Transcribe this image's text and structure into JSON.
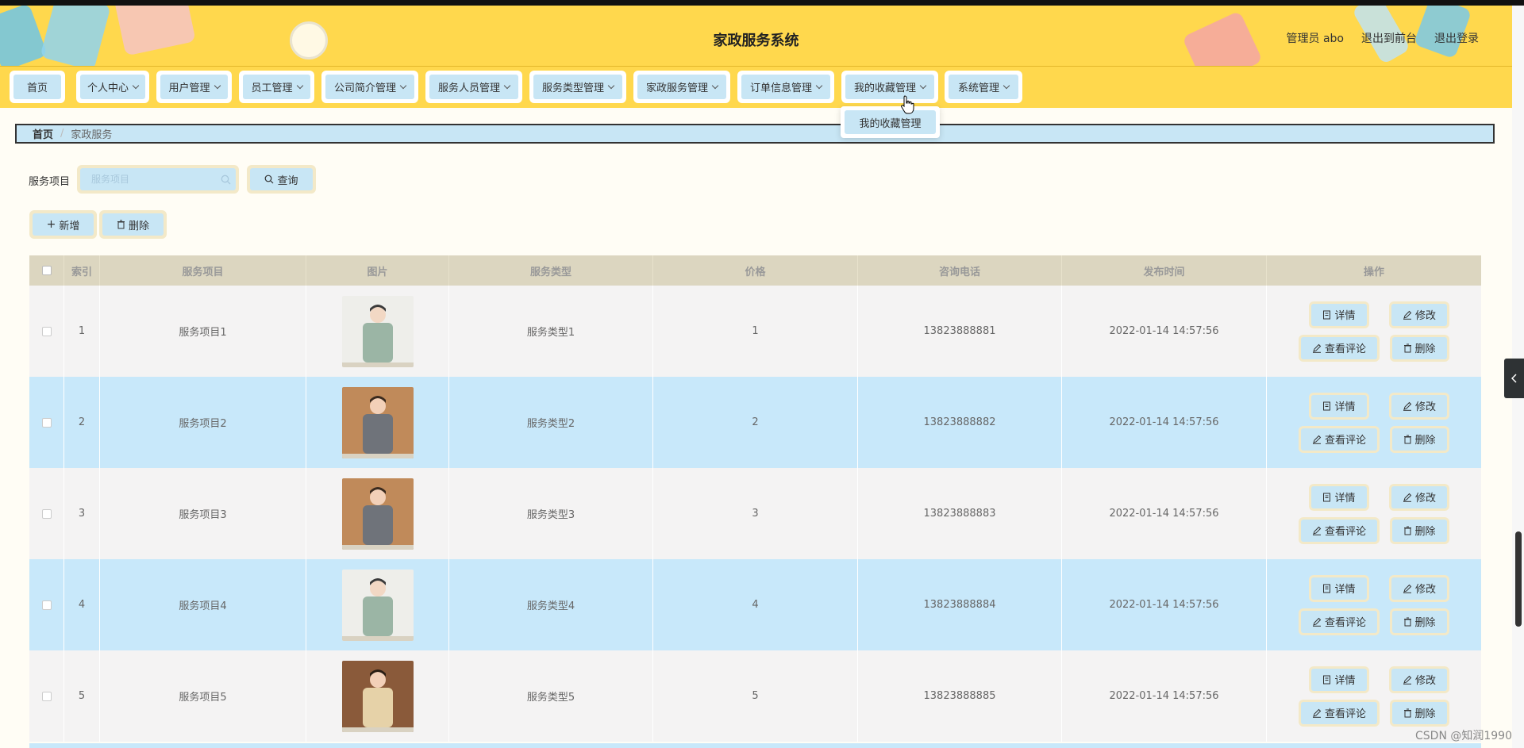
{
  "header": {
    "title": "家政服务系统",
    "links": [
      "管理员 abo",
      "退出到前台",
      "退出登录"
    ]
  },
  "nav": [
    {
      "label": "首页",
      "dropdown": false
    },
    {
      "label": "个人中心",
      "dropdown": true
    },
    {
      "label": "用户管理",
      "dropdown": true
    },
    {
      "label": "员工管理",
      "dropdown": true
    },
    {
      "label": "公司简介管理",
      "dropdown": true
    },
    {
      "label": "服务人员管理",
      "dropdown": true
    },
    {
      "label": "服务类型管理",
      "dropdown": true
    },
    {
      "label": "家政服务管理",
      "dropdown": true
    },
    {
      "label": "订单信息管理",
      "dropdown": true
    },
    {
      "label": "我的收藏管理",
      "dropdown": true
    },
    {
      "label": "系统管理",
      "dropdown": true
    }
  ],
  "dropdown": {
    "items": [
      "我的收藏管理"
    ]
  },
  "breadcrumb": {
    "home": "首页",
    "separator": "/",
    "current": "家政服务"
  },
  "search": {
    "label": "服务项目",
    "placeholder": "服务项目",
    "value": "",
    "button": "查询"
  },
  "actions": {
    "add": "新增",
    "delete": "删除"
  },
  "table": {
    "columns": [
      "索引",
      "服务项目",
      "图片",
      "服务类型",
      "价格",
      "咨询电话",
      "发布时间",
      "操作"
    ],
    "rows": [
      {
        "index": "1",
        "item": "服务项目1",
        "type": "服务类型1",
        "price": "1",
        "phone": "13823888881",
        "time": "2022-01-14 14:57:56",
        "photo": "green"
      },
      {
        "index": "2",
        "item": "服务项目2",
        "type": "服务类型2",
        "price": "2",
        "phone": "13823888882",
        "time": "2022-01-14 14:57:56",
        "photo": "gray"
      },
      {
        "index": "3",
        "item": "服务项目3",
        "type": "服务类型3",
        "price": "3",
        "phone": "13823888883",
        "time": "2022-01-14 14:57:56",
        "photo": "gray"
      },
      {
        "index": "4",
        "item": "服务项目4",
        "type": "服务类型4",
        "price": "4",
        "phone": "13823888884",
        "time": "2022-01-14 14:57:56",
        "photo": "green"
      },
      {
        "index": "5",
        "item": "服务项目5",
        "type": "服务类型5",
        "price": "5",
        "phone": "13823888885",
        "time": "2022-01-14 14:57:56",
        "photo": "beige"
      }
    ],
    "row_buttons": [
      "详情",
      "修改",
      "查看评论",
      "删除"
    ]
  },
  "watermark": "CSDN @知润1990",
  "colors": {
    "header": "#ffd84d",
    "button": "#c8e6f5",
    "button_border": "#f3e9c8",
    "row_even": "#c8e8fa",
    "row_odd": "#f4f3f3",
    "thead": "#dcd6c0"
  }
}
